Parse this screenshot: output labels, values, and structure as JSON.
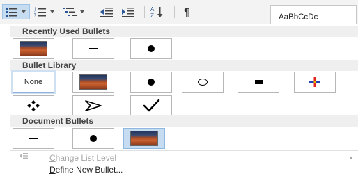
{
  "ribbon": {
    "style_preview": "AaBbCcDc",
    "buttons": [
      {
        "name": "bullets-button",
        "icon": "bullet-list-icon",
        "selected": true
      },
      {
        "name": "numbering-button",
        "icon": "numbered-list-icon"
      },
      {
        "name": "multilevel-list-button",
        "icon": "multilevel-list-icon"
      },
      {
        "name": "decrease-indent-button",
        "icon": "decrease-indent-icon"
      },
      {
        "name": "increase-indent-button",
        "icon": "increase-indent-icon"
      },
      {
        "name": "sort-button",
        "icon": "sort-az-icon"
      },
      {
        "name": "show-formatting-button",
        "icon": "pilcrow-icon",
        "glyph": "¶"
      }
    ]
  },
  "sections": {
    "recent": "Recently Used Bullets",
    "library": "Bullet Library",
    "document": "Document Bullets"
  },
  "recent_bullets": [
    {
      "kind": "picture",
      "icon": "picture-bullet-icon"
    },
    {
      "kind": "dash",
      "icon": "dash-bullet-icon"
    },
    {
      "kind": "dot",
      "icon": "dot-bullet-icon"
    }
  ],
  "library_bullets": [
    {
      "kind": "none",
      "label": "None",
      "current": true
    },
    {
      "kind": "picture",
      "icon": "picture-bullet-icon"
    },
    {
      "kind": "dot",
      "icon": "dot-bullet-icon"
    },
    {
      "kind": "circle",
      "icon": "hollow-circle-bullet-icon"
    },
    {
      "kind": "square",
      "icon": "square-bullet-icon"
    },
    {
      "kind": "colorcross",
      "icon": "color-cross-bullet-icon"
    },
    {
      "kind": "diamonds",
      "icon": "four-diamonds-bullet-icon"
    },
    {
      "kind": "arrow",
      "icon": "arrowhead-bullet-icon"
    },
    {
      "kind": "check",
      "icon": "checkmark-bullet-icon"
    }
  ],
  "document_bullets": [
    {
      "kind": "dash",
      "icon": "dash-bullet-icon"
    },
    {
      "kind": "dot",
      "icon": "dot-bullet-icon"
    },
    {
      "kind": "picture",
      "icon": "picture-bullet-icon",
      "highlighted": true
    }
  ],
  "menu": {
    "change_level": {
      "accel": "C",
      "rest": "hange List Level",
      "enabled": false
    },
    "define_new": {
      "accel": "D",
      "rest": "efine New Bullet...",
      "enabled": true
    }
  },
  "colors": {
    "selection": "#c5dcf1",
    "section_header_bg": "#efefef",
    "disabled_text": "#a6a6a6"
  }
}
